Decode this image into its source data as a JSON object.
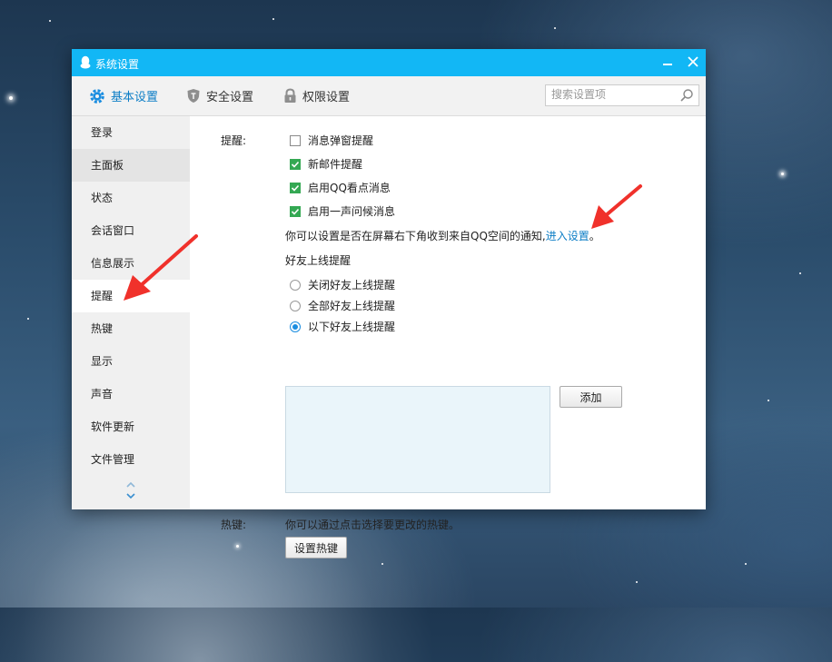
{
  "window": {
    "title": "系统设置"
  },
  "tabs": [
    {
      "label": "基本设置",
      "icon": "gear-icon",
      "active": true
    },
    {
      "label": "安全设置",
      "icon": "shield-icon",
      "active": false
    },
    {
      "label": "权限设置",
      "icon": "lock-icon",
      "active": false
    }
  ],
  "search": {
    "placeholder": "搜索设置项",
    "value": ""
  },
  "sidebar": {
    "items": [
      {
        "label": "登录"
      },
      {
        "label": "主面板"
      },
      {
        "label": "状态"
      },
      {
        "label": "会话窗口"
      },
      {
        "label": "信息展示"
      },
      {
        "label": "提醒"
      },
      {
        "label": "热键"
      },
      {
        "label": "显示"
      },
      {
        "label": "声音"
      },
      {
        "label": "软件更新"
      },
      {
        "label": "文件管理"
      }
    ],
    "active_item": "提醒"
  },
  "reminder": {
    "section_label": "提醒:",
    "checkboxes": [
      {
        "label": "消息弹窗提醒",
        "checked": false
      },
      {
        "label": "新邮件提醒",
        "checked": true
      },
      {
        "label": "启用QQ看点消息",
        "checked": true
      },
      {
        "label": "启用一声问候消息",
        "checked": true
      }
    ],
    "notice_text": "你可以设置是否在屏幕右下角收到来自QQ空间的通知,",
    "notice_link": "进入设置",
    "notice_end": "。",
    "friend_online_title": "好友上线提醒",
    "radios": [
      {
        "label": "关闭好友上线提醒",
        "checked": false
      },
      {
        "label": "全部好友上线提醒",
        "checked": false
      },
      {
        "label": "以下好友上线提醒",
        "checked": true
      }
    ],
    "add_button": "添加"
  },
  "hotkey": {
    "section_label": "热键:",
    "description": "你可以通过点击选择要更改的热键。",
    "button": "设置热键"
  },
  "colors": {
    "titlebar": "#12b7f5",
    "accent_link": "#0d7ec6",
    "checkbox_checked": "#34a853",
    "annotation_arrow": "#f0312b"
  }
}
